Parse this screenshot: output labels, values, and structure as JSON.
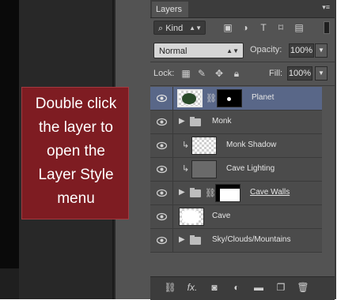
{
  "panel": {
    "tab_label": "Layers",
    "menu_icon": "panel-menu-icon",
    "filter": {
      "kind_label": "Kind",
      "icons": [
        "image-filter-icon",
        "adjustment-filter-icon",
        "type-filter-icon",
        "shape-filter-icon",
        "smart-object-filter-icon"
      ]
    },
    "blend_mode": "Normal",
    "opacity_label": "Opacity:",
    "opacity_value": "100%",
    "lock_label": "Lock:",
    "fill_label": "Fill:",
    "fill_value": "100%"
  },
  "layers": [
    {
      "name": "Planet",
      "type": "layer-with-mask",
      "selected": true
    },
    {
      "name": "Monk",
      "type": "group"
    },
    {
      "name": "Monk Shadow",
      "type": "clipped-layer"
    },
    {
      "name": "Cave Lighting",
      "type": "clipped-layer"
    },
    {
      "name": "Cave Walls",
      "type": "group-with-mask"
    },
    {
      "name": "Cave",
      "type": "layer"
    },
    {
      "name": "Sky/Clouds/Mountains",
      "type": "group"
    }
  ],
  "bottom_toolbar_icons": [
    "link-layers-icon",
    "fx-icon",
    "add-mask-icon",
    "adjustment-layer-icon",
    "new-group-icon",
    "new-layer-icon",
    "delete-layer-icon"
  ],
  "callout": {
    "lines": [
      "Double click",
      "the layer to",
      "open the",
      "Layer Style",
      "menu"
    ]
  },
  "colors": {
    "selected_row": "#596788",
    "callout_bg": "#7e1c22",
    "panel_bg": "#4b4b4b"
  }
}
